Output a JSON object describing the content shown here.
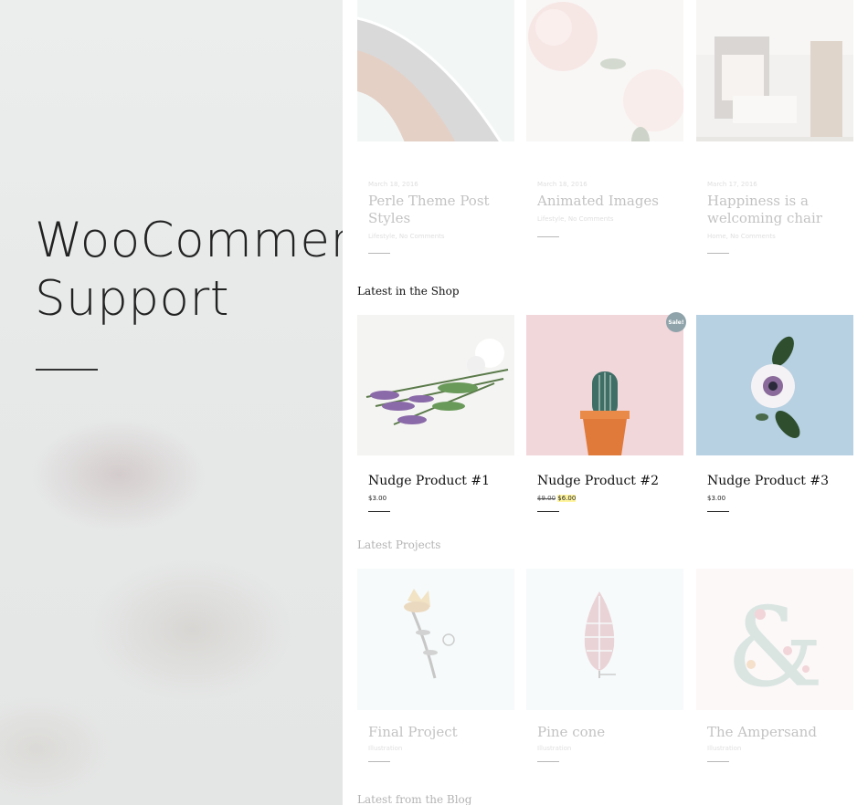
{
  "hero": {
    "title_line1": "WooCommerce",
    "title_line2": "Support"
  },
  "blog_posts": [
    {
      "date": "March 18, 2016",
      "title": "Perle Theme Post Styles",
      "meta": "Lifestyle, No Comments"
    },
    {
      "date": "March 18, 2016",
      "title": "Animated Images",
      "meta": "Lifestyle, No Comments"
    },
    {
      "date": "March 17, 2016",
      "title": "Happiness is a welcoming chair",
      "meta": "Home, No Comments"
    }
  ],
  "shop": {
    "heading": "Latest in the Shop",
    "sale_badge": "Sale!",
    "products": [
      {
        "title": "Nudge Product #1",
        "price": "$3.00"
      },
      {
        "title": "Nudge Product #2",
        "old_price": "$9.00",
        "price": "$6.00"
      },
      {
        "title": "Nudge Product #3",
        "price": "$3.00"
      }
    ]
  },
  "projects": {
    "heading": "Latest Projects",
    "items": [
      {
        "title": "Final Project",
        "meta": "Illustration"
      },
      {
        "title": "Pine cone",
        "meta": "Illustration"
      },
      {
        "title": "The Ampersand",
        "meta": "Illustration"
      }
    ]
  },
  "blog": {
    "heading": "Latest from the Blog"
  },
  "icons": [
    "architecture-photo",
    "peony-photo",
    "armchair-photo",
    "lavender-photo",
    "cactus-photo",
    "anemone-photo",
    "flower-illustration",
    "pinecone-illustration",
    "ampersand-illustration"
  ],
  "colors": {
    "accent_sale": "#8fa3aa",
    "price_highlight": "#fff5a0",
    "text_dark": "#111111"
  }
}
